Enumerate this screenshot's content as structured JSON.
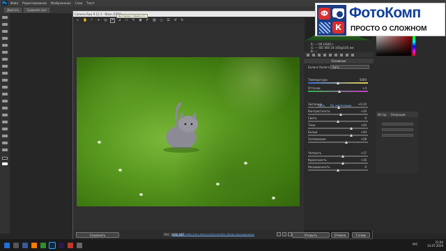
{
  "ps": {
    "menu": [
      "Файл",
      "Редактирование",
      "Изображение",
      "Слои",
      "Текст"
    ],
    "options": [
      "Двигать",
      "Сравнить все"
    ],
    "layers_tabs": [
      "Истор",
      "Операции"
    ]
  },
  "camera_raw": {
    "title": "Camera Raw 9.12.1  -  Nikon D750",
    "tooltip": "Инструмент «Рамка» (C)",
    "zoom": "10,6%",
    "filename": "DSC_0466.NEF",
    "readout": [
      "R:  ---   f/8  1/640 с",
      "G:  ---   ISO 400   24-105@105 мм",
      "B:  ---"
    ],
    "panel_title": "Основные",
    "wb_label": "Баланс белого:",
    "wb_value": "Авто",
    "auto_link": "Авто",
    "default_link": "По умолчанию",
    "sliders": [
      {
        "label": "Температура",
        "value": "5000",
        "pos": 0.5
      },
      {
        "label": "Оттенок",
        "value": "+4",
        "pos": 0.52
      },
      {
        "label": "Экспонир.",
        "value": "+0,10",
        "pos": 0.51
      },
      {
        "label": "Контрастность",
        "value": "+10",
        "pos": 0.55
      },
      {
        "label": "Света",
        "value": "0",
        "pos": 0.5
      },
      {
        "label": "Тени",
        "value": "+44",
        "pos": 0.72
      },
      {
        "label": "Белые",
        "value": "+44",
        "pos": 0.72
      },
      {
        "label": "Затемнение",
        "value": "+28",
        "pos": 0.64
      },
      {
        "label": "Четкость",
        "value": "+17",
        "pos": 0.58
      },
      {
        "label": "Красочность",
        "value": "+16",
        "pos": 0.58
      },
      {
        "label": "Насыщенность",
        "value": "0",
        "pos": 0.5
      }
    ],
    "save_button": "Сохранить изображение...",
    "footer_info": "Adobe RGB (1998); 8 бит; 6016 на 4016 (24,2МП); 300 ppi; Экранный вывод",
    "open_button": "Открыть изображение",
    "cancel_button": "Отмена",
    "done_button": "Готово"
  },
  "brand": {
    "title": "ФотоКомп",
    "subtitle": "ПРОСТО О СЛОЖНОМ",
    "logo_left": "Ф",
    "logo_right": "К"
  },
  "tray": {
    "time": "21:04",
    "date": "14.07.2019",
    "lang": "РУС"
  }
}
